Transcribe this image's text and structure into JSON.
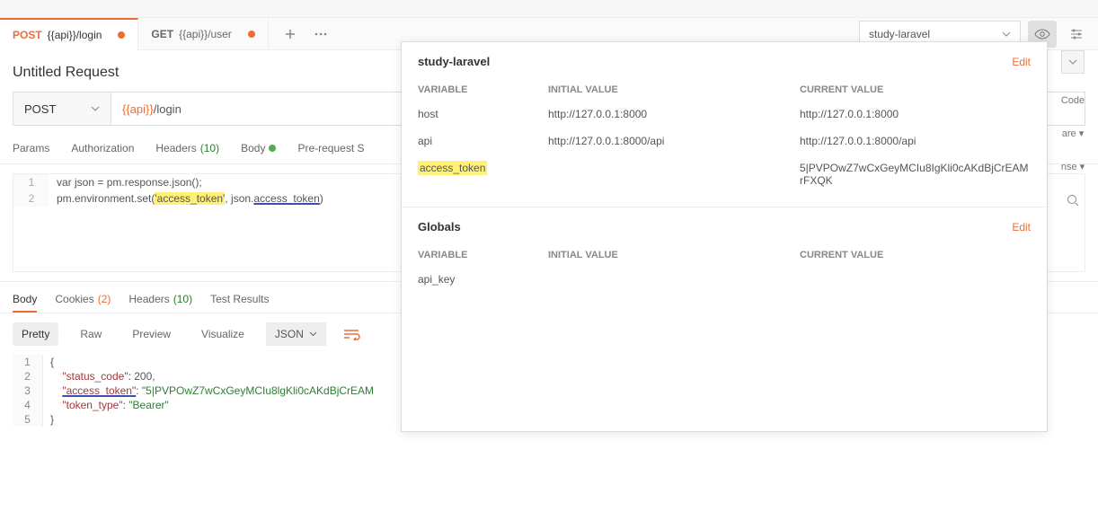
{
  "tabs": [
    {
      "method": "POST",
      "path": "{{api}}/login",
      "dirty": true,
      "active": true
    },
    {
      "method": "GET",
      "path": "{{api}}/user",
      "dirty": true,
      "active": false
    }
  ],
  "environment": {
    "selected": "study-laravel",
    "edit_label": "Edit",
    "headers": {
      "variable": "VARIABLE",
      "initial": "INITIAL VALUE",
      "current": "CURRENT VALUE"
    },
    "section_title": "study-laravel",
    "rows": [
      {
        "name": "host",
        "initial": "http://127.0.0.1:8000",
        "current": "http://127.0.0.1:8000",
        "highlight": false
      },
      {
        "name": "api",
        "initial": "http://127.0.0.1:8000/api",
        "current": "http://127.0.0.1:8000/api",
        "highlight": false
      },
      {
        "name": "access_token",
        "initial": "",
        "current": "5|PVPOwZ7wCxGeyMCIu8IgKli0cAKdBjCrEAMrFXQK",
        "highlight": true
      }
    ],
    "globals_title": "Globals",
    "globals_rows": [
      {
        "name": "api_key",
        "initial": "",
        "current": ""
      }
    ]
  },
  "request": {
    "name": "Untitled Request",
    "method": "POST",
    "url_var": "{{api}}",
    "url_rest": "/login"
  },
  "req_tabs": {
    "params": "Params",
    "auth": "Authorization",
    "headers": "Headers",
    "headers_count": "(10)",
    "body": "Body",
    "prerequest": "Pre-request S"
  },
  "script": {
    "l1": "var json = pm.response.json();",
    "l2a": "pm.environment.set(",
    "l2b": "'access_token'",
    "l2c": ", json.",
    "l2d": "access_token",
    "l2e": ")"
  },
  "resp_tabs": {
    "body": "Body",
    "cookies": "Cookies",
    "cookies_count": "(2)",
    "headers": "Headers",
    "headers_count": "(10)",
    "tests": "Test Results"
  },
  "resp_toolbar": {
    "pretty": "Pretty",
    "raw": "Raw",
    "preview": "Preview",
    "visualize": "Visualize",
    "format": "JSON"
  },
  "json": {
    "l1": "{",
    "l2_key": "\"status_code\"",
    "l2_val": "200",
    "l3_key": "\"access_token\"",
    "l3_val": "\"5|PVPOwZ7wCxGeyMCIu8lgKli0cAKdBjCrEAM",
    "l4_key": "\"token_type\"",
    "l4_val": "\"Bearer\"",
    "l5": "}"
  },
  "right_strip": {
    "code": "Code",
    "share": "are",
    "response": "nse",
    "search": "Q"
  }
}
